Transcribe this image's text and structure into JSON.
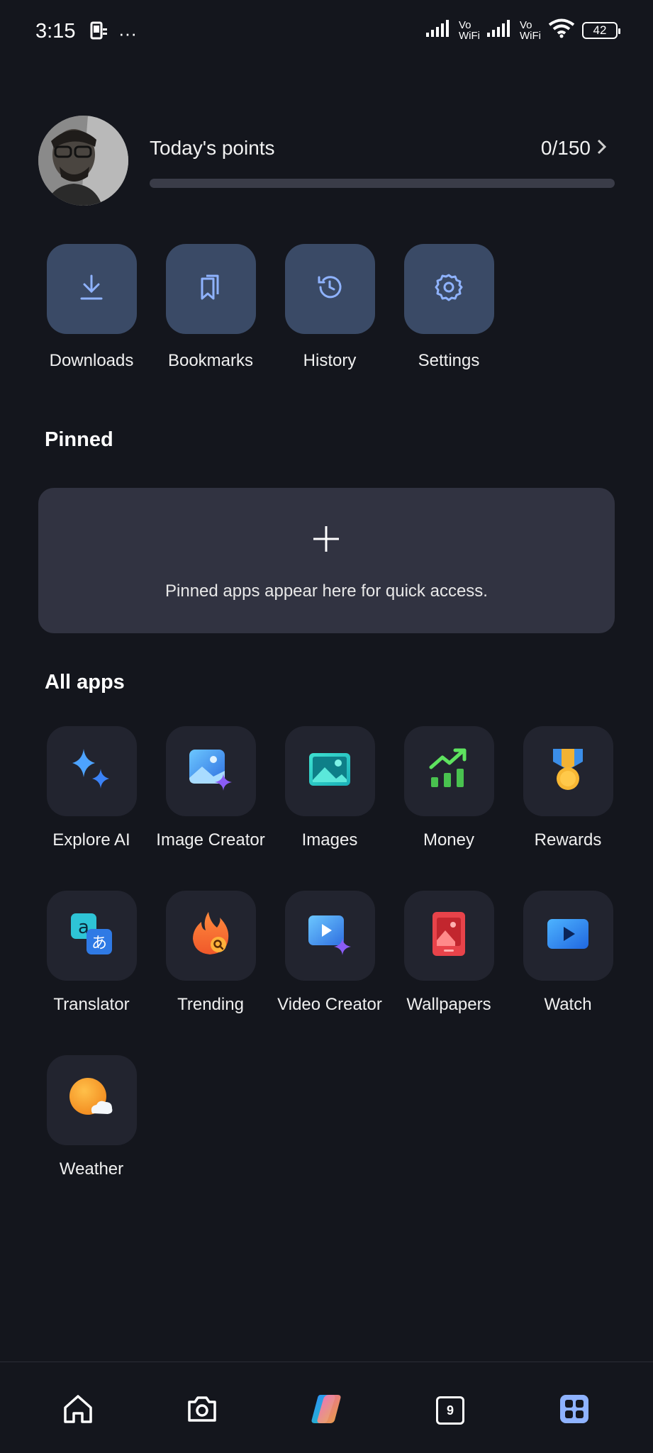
{
  "status_bar": {
    "time": "3:15",
    "more": "···",
    "vo_top": "Vo",
    "vo_bottom": "WiFi",
    "battery": "42"
  },
  "profile": {
    "points_label": "Today's points",
    "points_value": "0/150",
    "points_progress": 0
  },
  "quick_actions": [
    {
      "label": "Downloads",
      "icon": "download-icon"
    },
    {
      "label": "Bookmarks",
      "icon": "bookmarks-icon"
    },
    {
      "label": "History",
      "icon": "history-icon"
    },
    {
      "label": "Settings",
      "icon": "gear-icon"
    }
  ],
  "pinned": {
    "title": "Pinned",
    "empty_text": "Pinned apps appear here for quick access."
  },
  "all_apps": {
    "title": "All apps",
    "items": [
      {
        "label": "Explore AI",
        "icon": "sparkle-icon"
      },
      {
        "label": "Image Creator",
        "icon": "image-creator-icon"
      },
      {
        "label": "Images",
        "icon": "images-icon"
      },
      {
        "label": "Money",
        "icon": "money-chart-icon"
      },
      {
        "label": "Rewards",
        "icon": "medal-icon"
      },
      {
        "label": "Translator",
        "icon": "translator-icon"
      },
      {
        "label": "Trending",
        "icon": "flame-icon"
      },
      {
        "label": "Video Creator",
        "icon": "video-creator-icon"
      },
      {
        "label": "Wallpapers",
        "icon": "wallpaper-icon"
      },
      {
        "label": "Watch",
        "icon": "play-icon"
      },
      {
        "label": "Weather",
        "icon": "weather-icon"
      }
    ]
  },
  "bottom_nav": {
    "tab_count": "9",
    "items": [
      "home-icon",
      "camera-icon",
      "copilot-icon",
      "tabs-icon",
      "apps-grid-icon"
    ]
  },
  "colors": {
    "background": "#14161d",
    "quick_tile": "#3a4a66",
    "app_tile": "#22242f",
    "pinned_card": "#313341",
    "accent_blue": "#8fb3ff"
  }
}
